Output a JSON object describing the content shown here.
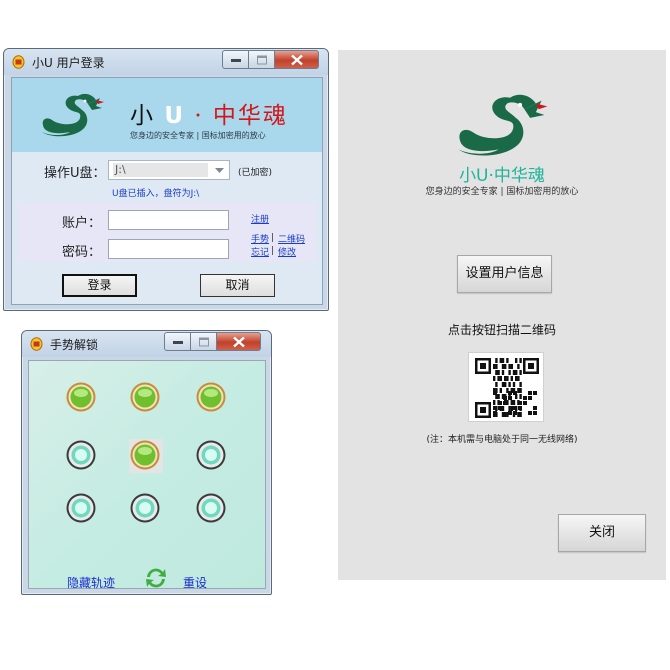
{
  "login_window": {
    "title": "小U 用户登录",
    "brand_part1": "小",
    "brand_part2": "U",
    "brand_part3": "· 中华魂",
    "tagline": "您身边的安全专家 | 国标加密用的放心",
    "udisk_label": "操作U盘：",
    "udisk_value": "J:\\",
    "encrypted_status": "(已加密)",
    "inserted_msg": "U盘已插入，盘符为J:\\",
    "account_label": "账户：",
    "password_label": "密码：",
    "account_value": "",
    "password_value": "",
    "register_link": "注册",
    "gesture_link": "手势",
    "qrcode_link": "二维码",
    "forgot_link": "忘记",
    "modify_link": "修改",
    "separator": "|",
    "login_button": "登录",
    "cancel_button": "取消"
  },
  "gesture_window": {
    "title": "手势解锁",
    "dots": [
      {
        "state": "active"
      },
      {
        "state": "active"
      },
      {
        "state": "active"
      },
      {
        "state": "inactive"
      },
      {
        "state": "active-selected"
      },
      {
        "state": "inactive"
      },
      {
        "state": "inactive"
      },
      {
        "state": "inactive"
      },
      {
        "state": "inactive"
      }
    ],
    "hide_trail_label": "隐藏轨迹",
    "reset_label": "重设",
    "refresh_icon": "refresh-icon"
  },
  "phone_panel": {
    "brand": "小U·中华魂",
    "tagline": "您身边的安全专家 | 国标加密用的放心",
    "setup_button": "设置用户信息",
    "scan_hint": "点击按钮扫描二维码",
    "note": "(注：本机需与电脑处于同一无线网络)",
    "close_button": "关闭"
  },
  "colors": {
    "dragon_green": "#1a6a48",
    "brand_red": "#d3161a",
    "link_blue": "#1a3ec8",
    "phone_brand_teal": "#1fb59a",
    "banner_blue": "#a9d8ec"
  }
}
